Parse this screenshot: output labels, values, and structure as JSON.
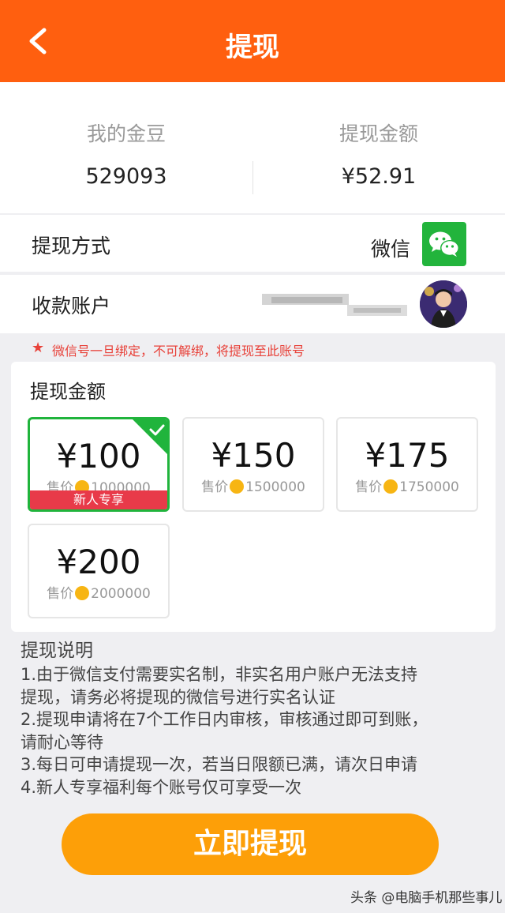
{
  "header": {
    "title": "提现",
    "back_icon": "chevron-left-icon",
    "background": "#ff5f0f"
  },
  "summary": {
    "beans_label": "我的金豆",
    "beans_value": "529093",
    "amount_label": "提现金额",
    "amount_value": "¥52.91"
  },
  "method": {
    "label": "提现方式",
    "value": "微信",
    "icon": "wechat-icon"
  },
  "account": {
    "label": "收款账户",
    "name_blurred": true
  },
  "notice": {
    "icon": "star-icon",
    "text": "微信号一旦绑定，不可解绑，将提现至此账号"
  },
  "withdraw": {
    "title": "提现金额",
    "price_label": "售价",
    "options": [
      {
        "amount": "¥100",
        "beans": "1000000",
        "tag": "新人专享",
        "selected": true
      },
      {
        "amount": "¥150",
        "beans": "1500000",
        "tag": "",
        "selected": false
      },
      {
        "amount": "¥175",
        "beans": "1750000",
        "tag": "",
        "selected": false
      },
      {
        "amount": "¥200",
        "beans": "2000000",
        "tag": "",
        "selected": false
      }
    ]
  },
  "explain": {
    "title": "提现说明",
    "lines": [
      "1.由于微信支付需要实名制，非实名用户账户无法支持",
      "提现，请务必将提现的微信号进行实名认证",
      "2.提现申请将在7个工作日内审核，审核通过即可到账，",
      "请耐心等待",
      "3.每日可申请提现一次，若当日限额已满，请次日申请",
      "4.新人专享福利每个账号仅可享受一次"
    ]
  },
  "submit": {
    "label": "立即提现",
    "color": "#fd9f08"
  },
  "watermark": "头条 @电脑手机那些事儿"
}
